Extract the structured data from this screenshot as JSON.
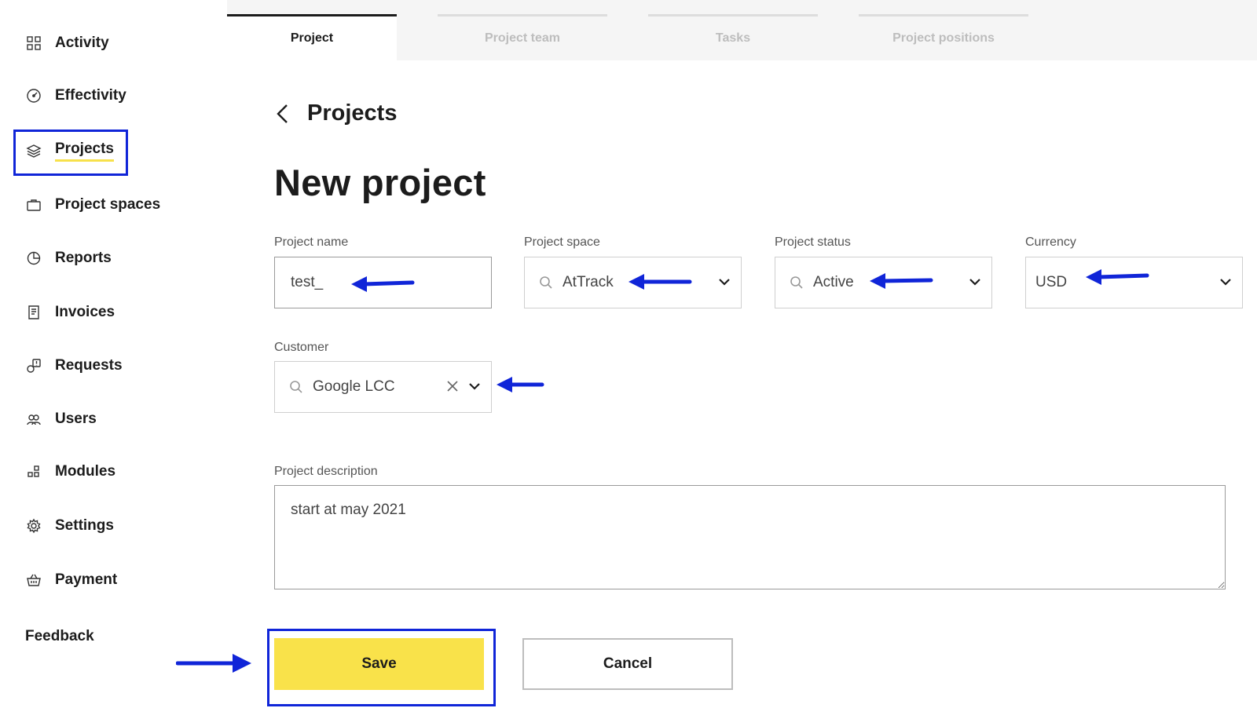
{
  "sidebar": {
    "items": [
      {
        "label": "Activity",
        "icon": "grid-icon"
      },
      {
        "label": "Effectivity",
        "icon": "gauge-icon"
      },
      {
        "label": "Projects",
        "icon": "layers-icon"
      },
      {
        "label": "Project spaces",
        "icon": "briefcase-icon"
      },
      {
        "label": "Reports",
        "icon": "pie-chart-icon"
      },
      {
        "label": "Invoices",
        "icon": "receipt-icon"
      },
      {
        "label": "Requests",
        "icon": "request-icon"
      },
      {
        "label": "Users",
        "icon": "users-icon"
      },
      {
        "label": "Modules",
        "icon": "modules-icon"
      },
      {
        "label": "Settings",
        "icon": "gear-icon"
      },
      {
        "label": "Payment",
        "icon": "basket-icon"
      }
    ],
    "active": "Projects",
    "feedback": "Feedback",
    "accent_color": "#f7e14b"
  },
  "tabs": [
    {
      "label": "Project"
    },
    {
      "label": "Project team"
    },
    {
      "label": "Tasks"
    },
    {
      "label": "Project positions"
    }
  ],
  "breadcrumb": {
    "title": "Projects"
  },
  "page_title": "New project",
  "form": {
    "project_name": {
      "label": "Project name",
      "value": "test_"
    },
    "project_space": {
      "label": "Project space",
      "value": "AtTrack"
    },
    "project_status": {
      "label": "Project status",
      "value": "Active"
    },
    "currency": {
      "label": "Currency",
      "value": "USD"
    },
    "customer": {
      "label": "Customer",
      "value": "Google LCC"
    },
    "description": {
      "label": "Project description",
      "value": "start at may 2021"
    }
  },
  "buttons": {
    "save": "Save",
    "cancel": "Cancel"
  },
  "colors": {
    "annotation": "#1025d8",
    "primary": "#f9e24a"
  }
}
